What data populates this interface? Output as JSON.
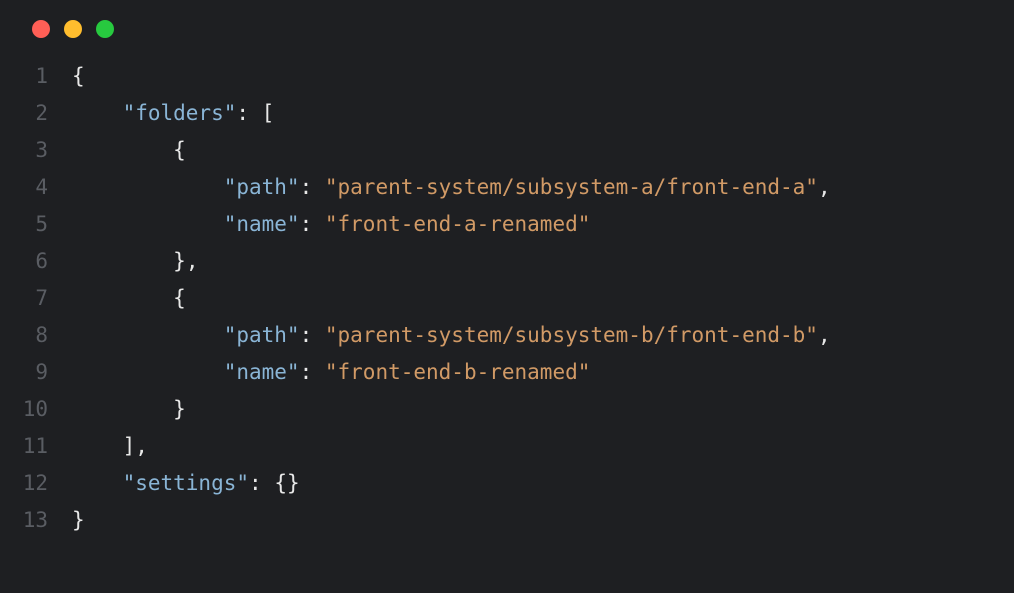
{
  "window": {
    "traffic_lights": [
      "close",
      "minimize",
      "zoom"
    ]
  },
  "gutter": {
    "lines": [
      "1",
      "2",
      "3",
      "4",
      "5",
      "6",
      "7",
      "8",
      "9",
      "10",
      "11",
      "12",
      "13"
    ]
  },
  "code": {
    "lines": [
      {
        "indent": 0,
        "tokens": [
          {
            "t": "brace",
            "v": "{"
          }
        ]
      },
      {
        "indent": 1,
        "tokens": [
          {
            "t": "key",
            "v": "\"folders\""
          },
          {
            "t": "colon",
            "v": ": "
          },
          {
            "t": "bracket",
            "v": "["
          }
        ]
      },
      {
        "indent": 2,
        "tokens": [
          {
            "t": "brace",
            "v": "{"
          }
        ]
      },
      {
        "indent": 3,
        "tokens": [
          {
            "t": "key",
            "v": "\"path\""
          },
          {
            "t": "colon",
            "v": ": "
          },
          {
            "t": "string",
            "v": "\"parent-system/subsystem-a/front-end-a\""
          },
          {
            "t": "comma",
            "v": ","
          }
        ]
      },
      {
        "indent": 3,
        "tokens": [
          {
            "t": "key",
            "v": "\"name\""
          },
          {
            "t": "colon",
            "v": ": "
          },
          {
            "t": "string",
            "v": "\"front-end-a-renamed\""
          }
        ]
      },
      {
        "indent": 2,
        "tokens": [
          {
            "t": "brace",
            "v": "}"
          },
          {
            "t": "comma",
            "v": ","
          }
        ]
      },
      {
        "indent": 2,
        "tokens": [
          {
            "t": "brace",
            "v": "{"
          }
        ]
      },
      {
        "indent": 3,
        "tokens": [
          {
            "t": "key",
            "v": "\"path\""
          },
          {
            "t": "colon",
            "v": ": "
          },
          {
            "t": "string",
            "v": "\"parent-system/subsystem-b/front-end-b\""
          },
          {
            "t": "comma",
            "v": ","
          }
        ]
      },
      {
        "indent": 3,
        "tokens": [
          {
            "t": "key",
            "v": "\"name\""
          },
          {
            "t": "colon",
            "v": ": "
          },
          {
            "t": "string",
            "v": "\"front-end-b-renamed\""
          }
        ]
      },
      {
        "indent": 2,
        "tokens": [
          {
            "t": "brace",
            "v": "}"
          }
        ]
      },
      {
        "indent": 1,
        "tokens": [
          {
            "t": "bracket",
            "v": "]"
          },
          {
            "t": "comma",
            "v": ","
          }
        ]
      },
      {
        "indent": 1,
        "tokens": [
          {
            "t": "key",
            "v": "\"settings\""
          },
          {
            "t": "colon",
            "v": ": "
          },
          {
            "t": "brace",
            "v": "{}"
          }
        ]
      },
      {
        "indent": 0,
        "tokens": [
          {
            "t": "brace",
            "v": "}"
          }
        ]
      }
    ]
  },
  "indent_unit": "    "
}
